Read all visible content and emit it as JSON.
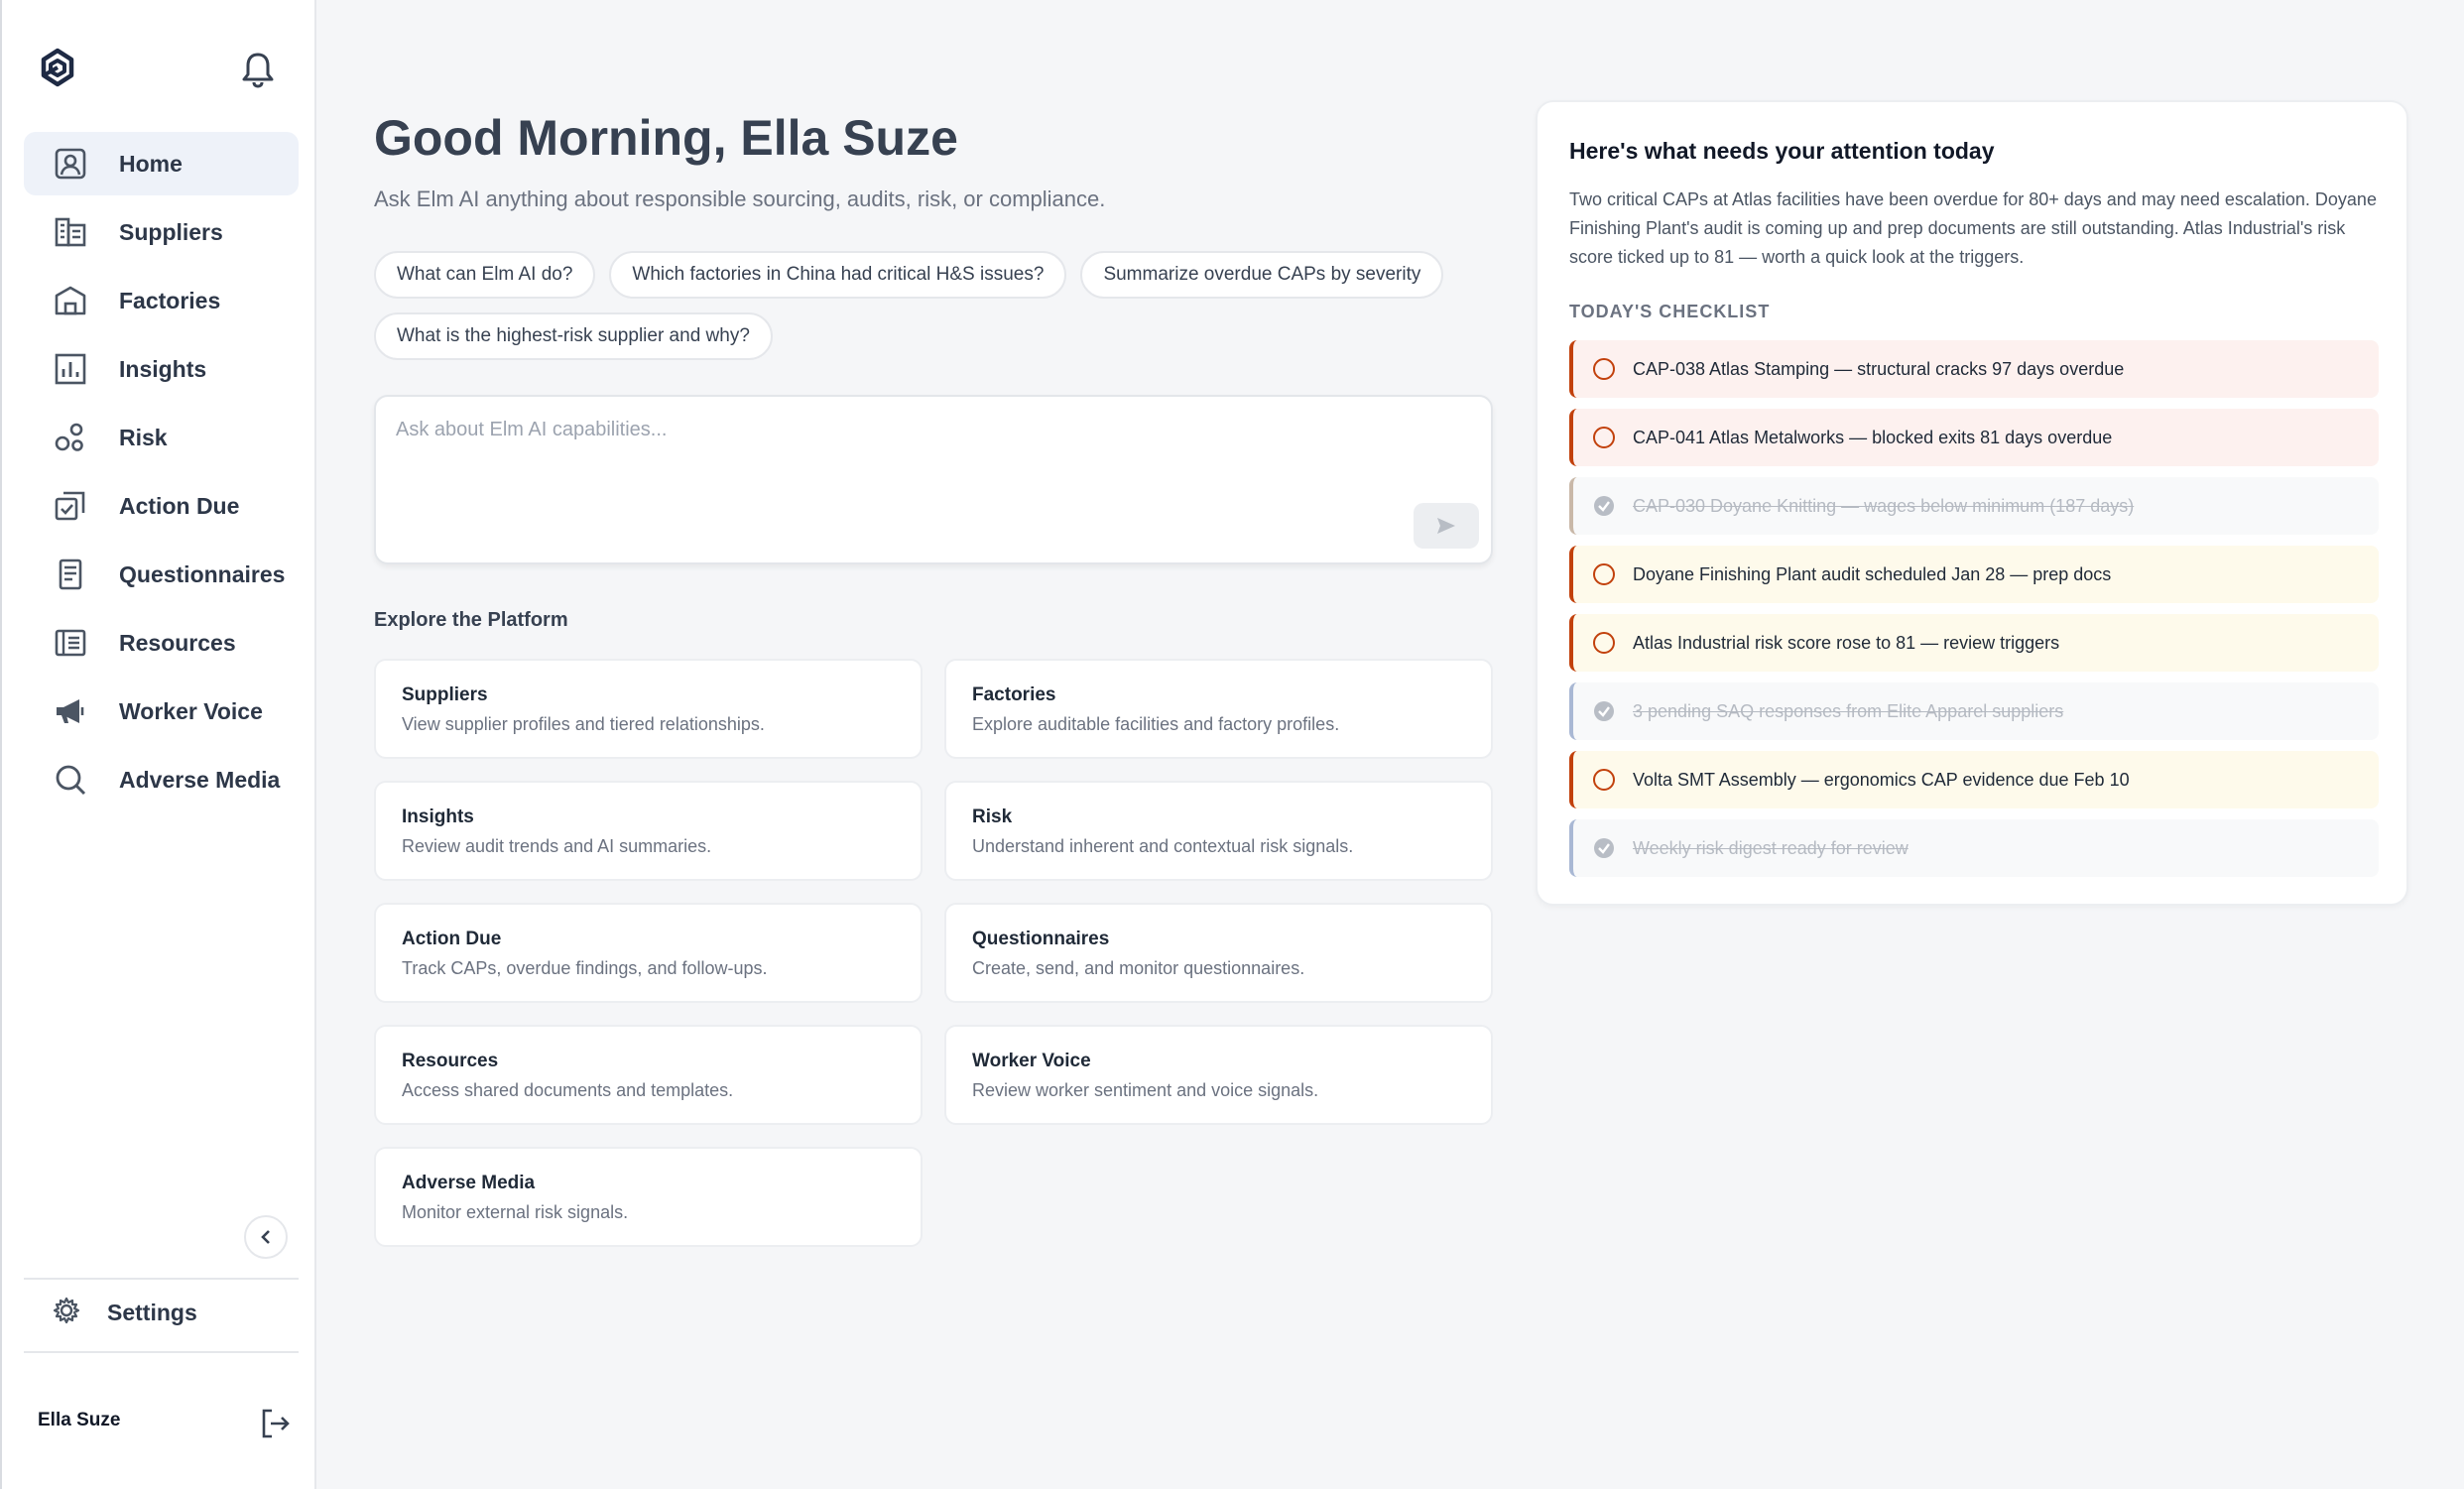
{
  "sidebar": {
    "items": [
      {
        "label": "Home",
        "icon": "home-icon",
        "active": true
      },
      {
        "label": "Suppliers",
        "icon": "suppliers-icon"
      },
      {
        "label": "Factories",
        "icon": "factory-icon"
      },
      {
        "label": "Insights",
        "icon": "insights-icon"
      },
      {
        "label": "Risk",
        "icon": "risk-icon"
      },
      {
        "label": "Action Due",
        "icon": "action-due-icon"
      },
      {
        "label": "Questionnaires",
        "icon": "questionnaire-icon"
      },
      {
        "label": "Resources",
        "icon": "resources-icon"
      },
      {
        "label": "Worker Voice",
        "icon": "megaphone-icon"
      },
      {
        "label": "Adverse Media",
        "icon": "search-icon"
      }
    ],
    "settings_label": "Settings",
    "user_name": "Ella Suze"
  },
  "main": {
    "greeting": "Good Morning, Ella Suze",
    "subtitle": "Ask Elm AI anything about responsible sourcing, audits, risk, or compliance.",
    "chips": [
      "What can Elm AI do?",
      "Which factories in China had critical H&S issues?",
      "Summarize overdue CAPs by severity",
      "What is the highest-risk supplier and why?"
    ],
    "ask_placeholder": "Ask about Elm AI capabilities...",
    "explore_title": "Explore the Platform",
    "cards": [
      {
        "title": "Suppliers",
        "desc": "View supplier profiles and tiered relationships."
      },
      {
        "title": "Factories",
        "desc": "Explore auditable facilities and factory profiles."
      },
      {
        "title": "Insights",
        "desc": "Review audit trends and AI summaries."
      },
      {
        "title": "Risk",
        "desc": "Understand inherent and contextual risk signals."
      },
      {
        "title": "Action Due",
        "desc": "Track CAPs, overdue findings, and follow-ups."
      },
      {
        "title": "Questionnaires",
        "desc": "Create, send, and monitor questionnaires."
      },
      {
        "title": "Resources",
        "desc": "Access shared documents and templates."
      },
      {
        "title": "Worker Voice",
        "desc": "Review worker sentiment and voice signals."
      },
      {
        "title": "Adverse Media",
        "desc": "Monitor external risk signals."
      }
    ]
  },
  "attention": {
    "title": "Here's what needs your attention today",
    "summary": "Two critical CAPs at Atlas facilities have been overdue for 80+ days and may need escalation. Doyane Finishing Plant's audit is coming up and prep documents are still outstanding. Atlas Industrial's risk score ticked up to 81 — worth a quick look at the triggers.",
    "checklist_title": "TODAY'S CHECKLIST",
    "items": [
      {
        "label": "CAP-038 Atlas Stamping — structural cracks 97 days overdue",
        "status": "critical",
        "done": false
      },
      {
        "label": "CAP-041 Atlas Metalworks — blocked exits 81 days overdue",
        "status": "critical",
        "done": false
      },
      {
        "label": "CAP-030 Doyane Knitting — wages below minimum (187 days)",
        "status": "done",
        "done": true
      },
      {
        "label": "Doyane Finishing Plant audit scheduled Jan 28 — prep docs",
        "status": "warning",
        "done": false
      },
      {
        "label": "Atlas Industrial risk score rose to 81 — review triggers",
        "status": "warning",
        "done": false
      },
      {
        "label": "3 pending SAQ responses from Elite Apparel suppliers",
        "status": "done",
        "done": true
      },
      {
        "label": "Volta SMT Assembly — ergonomics CAP evidence due Feb 10",
        "status": "warning",
        "done": false
      },
      {
        "label": "Weekly risk digest ready for review",
        "status": "done",
        "done": true
      }
    ]
  },
  "colors": {
    "brand": "#1e2a44",
    "critical_bg": "#fdf1ef",
    "warning_bg": "#fefaeb",
    "accent_orange": "#c2410c"
  }
}
